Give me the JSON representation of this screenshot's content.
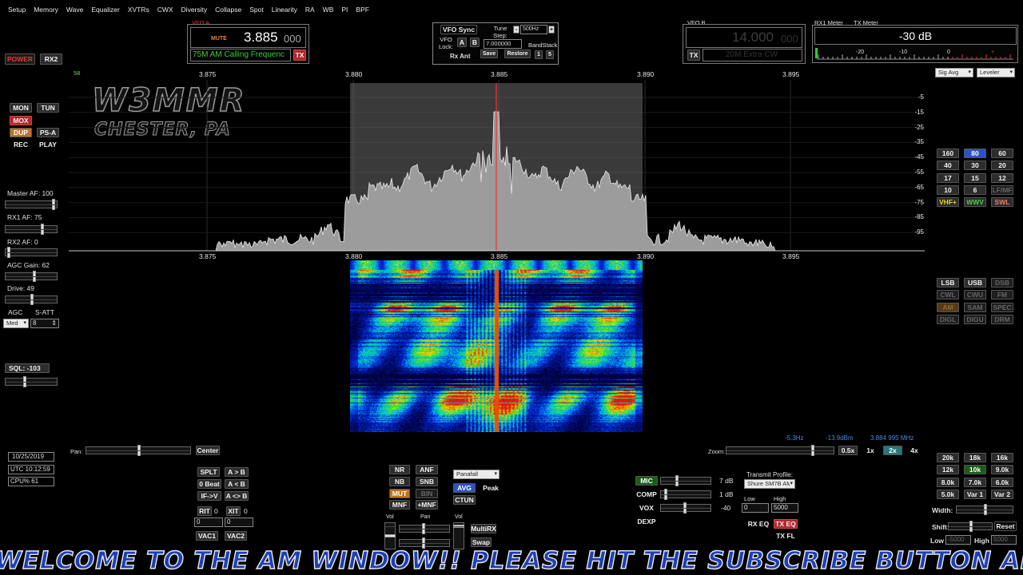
{
  "menu": [
    "Setup",
    "Memory",
    "Wave",
    "Equalizer",
    "XVTRs",
    "CWX",
    "Diversity",
    "Collapse",
    "Spot",
    "Linearity",
    "RA",
    "WB",
    "PI",
    "BPF"
  ],
  "left": {
    "power": "POWER",
    "rx2": "RX2",
    "mon": "MON",
    "tun": "TUN",
    "mox": "MOX",
    "dup": "DUP",
    "psa": "PS-A",
    "rec": "REC",
    "play": "PLAY",
    "master_af": "Master AF:  100",
    "rx1_af": "RX1 AF:  75",
    "rx2_af": "RX2 AF:  0",
    "agc_gain": "AGC Gain:  62",
    "drive": "Drive:  49",
    "agc": "AGC",
    "satt": "S-ATT",
    "agc_mode": "Med",
    "satt_value": "8",
    "sql": "SQL:  -103",
    "date": "10/25/2019",
    "utc": "UTC 10:12:59",
    "cpu": "CPU%  61",
    "fps": "58",
    "logo_line1": "W3MMR",
    "logo_line2": "CHESTER, PA"
  },
  "vfoa": {
    "label": "VFO A",
    "mute": "MUTE",
    "freq_main": "3.885",
    "freq_sub": "000",
    "band_text": "75M AM Calling Frequenc",
    "tx": "TX"
  },
  "vfocontrols": {
    "sync": "VFO Sync",
    "tune_step_label": "Tune Step:",
    "tune_step": "500Hz",
    "lock": "VFO Lock:",
    "a": "A",
    "b": "B",
    "freq": "7.000000",
    "bandstack": "BandStack",
    "rxant": "Rx Ant",
    "save": "Save",
    "restore": "Restore",
    "one": "1",
    "five": "5"
  },
  "vfob": {
    "label": "VFO B",
    "freq_main": "14.000",
    "freq_sub": "000",
    "band_text": "20M Extra CW",
    "tx": "TX"
  },
  "meters": {
    "rx1": "RX1 Meter",
    "tx": "TX Meter",
    "value": "-30 dB",
    "scale": [
      "-20",
      "-10",
      "0",
      "+"
    ],
    "rx_mode": "Sig Avg",
    "tx_mode": "Leveler"
  },
  "panadapter": {
    "freq_ticks": [
      "3.875",
      "3.880",
      "3.885",
      "3.890",
      "3.895"
    ],
    "db_ticks": [
      "-5",
      "-15",
      "-25",
      "-35",
      "-45",
      "-55",
      "-65",
      "-75",
      "-85",
      "-95"
    ]
  },
  "bands": [
    "160",
    "80",
    "60",
    "40",
    "30",
    "20",
    "17",
    "15",
    "12",
    "10",
    "6",
    "LF/MF",
    "VHF+",
    "WWV",
    "SWL"
  ],
  "modes": [
    "LSB",
    "USB",
    "DSB",
    "CWL",
    "CWU",
    "FM",
    "AM",
    "SAM",
    "SPEC",
    "DIGL",
    "DIGU",
    "DRM"
  ],
  "filters": [
    "20k",
    "18k",
    "16k",
    "12k",
    "10k",
    "9.0k",
    "8.0k",
    "7.0k",
    "6.0k",
    "5.0k",
    "Var 1",
    "Var 2"
  ],
  "right_lower": {
    "width": "Width:",
    "shift": "Shift:",
    "reset": "Reset",
    "low": "Low",
    "low_val": "-5000",
    "high": "High",
    "high_val": "5000"
  },
  "pan": {
    "label": "Pan:",
    "center": "Center"
  },
  "zoom": {
    "label": "Zoom:",
    "options": [
      "0.5x",
      "1x",
      "2x",
      "4x"
    ],
    "cursor_offset": "-5.3Hz",
    "cursor_dbm": "-13.9dBm",
    "cursor_freq": "3.884 995 MHz"
  },
  "dsp": {
    "splt": "SPLT",
    "ab": "A > B",
    "zerobeat": "0 Beat",
    "ba": "A < B",
    "iftov": "IF->V",
    "aswap": "A <> B",
    "rit": "RIT",
    "rit_val": "0",
    "xit": "XIT",
    "xit_val": "0",
    "rit_num": "0",
    "xit_num": "0",
    "vac1": "VAC1",
    "vac2": "VAC2",
    "nr": "NR",
    "anf": "ANF",
    "nb": "NB",
    "snb": "SNB",
    "mut": "MUT",
    "bin": "BIN",
    "mnf": "MNF",
    "addmnf": "+MNF",
    "display_mode": "Panafall",
    "avg": "AVG",
    "peak": "Peak",
    "ctun": "CTUN",
    "vol": "Vol",
    "panlbl": "Pan",
    "vol2": "Vol",
    "multirx": "MultiRX",
    "swap": "Swap"
  },
  "tx": {
    "mic": "MIC",
    "mic_val": "7 dB",
    "comp": "COMP",
    "comp_val": "1 dB",
    "vox": "VOX",
    "vox_val": "-40",
    "dexp": "DEXP",
    "profile_label": "Transmit Profile:",
    "profile": "Shure SM7B AM",
    "low": "Low",
    "low_val": "0",
    "high": "High",
    "high_val": "5000",
    "rxeq": "RX EQ",
    "txeq": "TX EQ",
    "txfl": "TX FL"
  },
  "banner": "WELCOME TO THE AM WINDOW!! PLEASE HIT THE SUBSCRIBE BUTTON AN",
  "colors": {
    "accent_red": "#b4262a",
    "vfo_green": "#37d137",
    "banner_blue": "#1d3fb8"
  }
}
